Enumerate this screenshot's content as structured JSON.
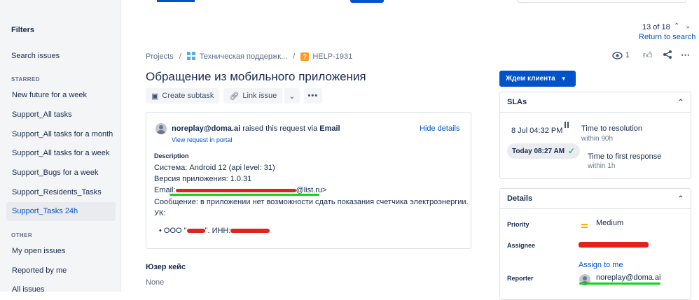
{
  "sidebar": {
    "title": "Filters",
    "search_link": "Search issues",
    "starred_heading": "STARRED",
    "starred": [
      "New future for a week",
      "Support_All tasks",
      "Support_All tasks for a month",
      "Support_All tasks for a week",
      "Support_Bugs for a week",
      "Support_Residents_Tasks",
      "Support_Tasks 24h"
    ],
    "other_heading": "OTHER",
    "other": [
      "My open issues",
      "Reported by me",
      "All issues"
    ]
  },
  "pager": {
    "position": "13 of 18",
    "return_link": "Return to search"
  },
  "breadcrumb": {
    "projects": "Projects",
    "project": "Техническая поддержк...",
    "issue_key": "HELP-1931"
  },
  "issue": {
    "title": "Обращение из мобильного приложения",
    "watchers": "1"
  },
  "toolbar": {
    "create_subtask": "Create subtask",
    "link_issue": "Link issue"
  },
  "status": {
    "label": "Ждем клиента"
  },
  "request": {
    "reporter_email": "noreplay@doma.ai",
    "raised_middle": "raised this request via",
    "channel": "Email",
    "view_portal": "View request in portal",
    "hide_details": "Hide details",
    "description_label": "Description",
    "lines": {
      "system": "Система: Android 12 (api level: 31)",
      "version": "Версия приложения: 1.0.31",
      "email_prefix": "Email:",
      "email_suffix": "@list.ru>",
      "message": "Сообщение: в приложении нет возможности сдать показания счетчика электроэнергии.",
      "uk": "УК:",
      "org_prefix": "• ООО \"",
      "org_middle": "\". ИНН:"
    }
  },
  "user_case": {
    "heading": "Юзер кейс",
    "value": "None"
  },
  "sla": {
    "title": "SLAs",
    "items": [
      {
        "time": "8 Jul 04:32 PM",
        "name": "Time to resolution",
        "within": "within 90h",
        "state": "paused"
      },
      {
        "time": "Today 08:27 AM",
        "name": "Time to first response",
        "within": "within 1h",
        "state": "met"
      }
    ]
  },
  "details": {
    "title": "Details",
    "priority_label": "Priority",
    "priority_value": "Medium",
    "assignee_label": "Assignee",
    "assign_to_me": "Assign to me",
    "reporter_label": "Reporter",
    "reporter_value": "noreplay@doma.ai"
  },
  "colors": {
    "accent": "#0052cc",
    "redaction": "#e2231a",
    "highlight": "#10d510",
    "priority_medium": "#ffab00",
    "sla_met": "#36b37e"
  }
}
